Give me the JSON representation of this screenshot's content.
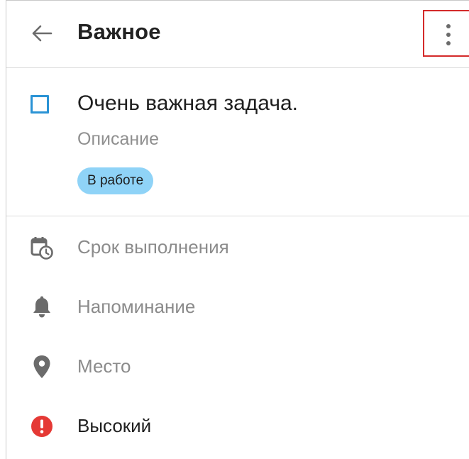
{
  "header": {
    "title": "Важное",
    "back_icon": "arrow-left-icon",
    "menu_icon": "more-vertical-icon"
  },
  "task": {
    "title": "Очень важная задача.",
    "description_placeholder": "Описание",
    "status_label": "В работе",
    "checkbox_checked": false,
    "checkbox_color": "#2a93d5",
    "status_color": "#8fd3f7"
  },
  "options": [
    {
      "label": "Срок выполнения",
      "icon": "calendar-clock-icon"
    },
    {
      "label": "Напоминание",
      "icon": "bell-icon"
    },
    {
      "label": "Место",
      "icon": "location-pin-icon"
    },
    {
      "label": "Высокий",
      "icon": "priority-high-icon",
      "color": "#e53935"
    }
  ]
}
